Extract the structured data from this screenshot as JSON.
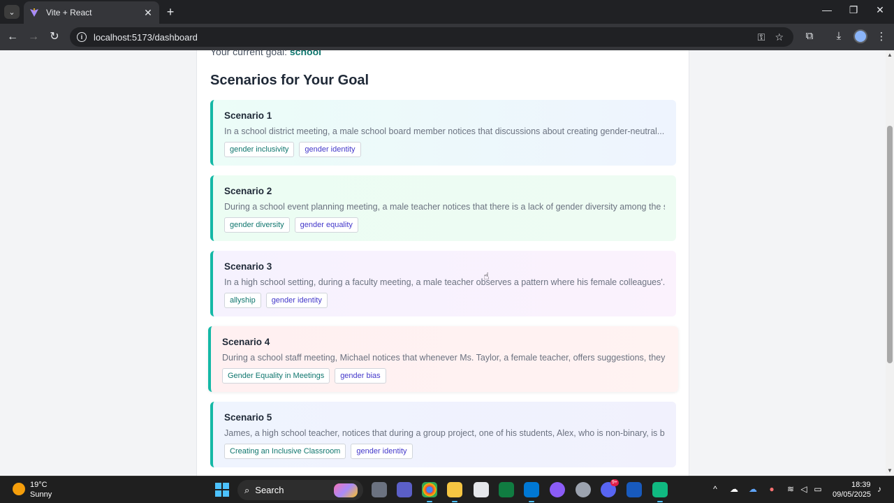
{
  "browser": {
    "tab_title": "Vite + React",
    "url": "localhost:5173/dashboard"
  },
  "page": {
    "goal_label": "Your current goal:",
    "goal_value": "school",
    "section_title": "Scenarios for Your Goal",
    "scenarios": [
      {
        "title": "Scenario 1",
        "description": "In a school district meeting, a male school board member notices that discussions about creating gender-neutral...",
        "tags": [
          "gender inclusivity",
          "gender identity"
        ]
      },
      {
        "title": "Scenario 2",
        "description": "During a school event planning meeting, a male teacher notices that there is a lack of gender diversity among the studen...",
        "tags": [
          "gender diversity",
          "gender equality"
        ]
      },
      {
        "title": "Scenario 3",
        "description": "In a high school setting, during a faculty meeting, a male teacher observes a pattern where his female colleagues'...",
        "tags": [
          "allyship",
          "gender identity"
        ]
      },
      {
        "title": "Scenario 4",
        "description": "During a school staff meeting, Michael notices that whenever Ms. Taylor, a female teacher, offers suggestions, they are...",
        "tags": [
          "Gender Equality in Meetings",
          "gender bias"
        ]
      },
      {
        "title": "Scenario 5",
        "description": "James, a high school teacher, notices that during a group project, one of his students, Alex, who is non-binary, is being...",
        "tags": [
          "Creating an Inclusive Classroom",
          "gender identity"
        ]
      }
    ],
    "colors": {
      "accent_border": "#14b8a6",
      "goal_value": "#0f766e",
      "tag_first": "#0f766e",
      "tag_second": "#4338ca"
    }
  },
  "taskbar": {
    "weather_temp": "19°C",
    "weather_desc": "Sunny",
    "search_label": "Search",
    "time": "18:39",
    "date": "09/05/2025",
    "discord_badge": "9+"
  }
}
